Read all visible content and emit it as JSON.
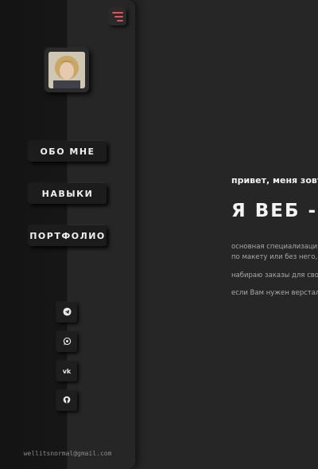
{
  "sidebar": {
    "menu_icon": "hamburger-menu-icon",
    "avatar_alt": "profile photo",
    "nav": [
      {
        "label": "ОБО МНЕ"
      },
      {
        "label": "НАВЫКИ"
      },
      {
        "label": "ПОРТФОЛИО"
      }
    ],
    "socials": [
      {
        "icon": "telegram-icon",
        "glyph": "✈"
      },
      {
        "icon": "whatsapp-icon",
        "glyph": "✆"
      },
      {
        "icon": "vk-icon",
        "glyph": "vk"
      },
      {
        "icon": "github-icon",
        "glyph": "◉"
      }
    ],
    "email": "wellitsnormal@gmail.com"
  },
  "main": {
    "greeting": "привет, меня зову",
    "headline": "Я ВЕБ - В",
    "paragraphs": [
      "основная специализаци",
      "по макету или без него,",
      "набираю заказы для сво",
      "если Вам нужен верстал"
    ]
  },
  "colors": {
    "accent": "#e2505c",
    "background": "#262626",
    "sidebar_dark": "#151515"
  }
}
